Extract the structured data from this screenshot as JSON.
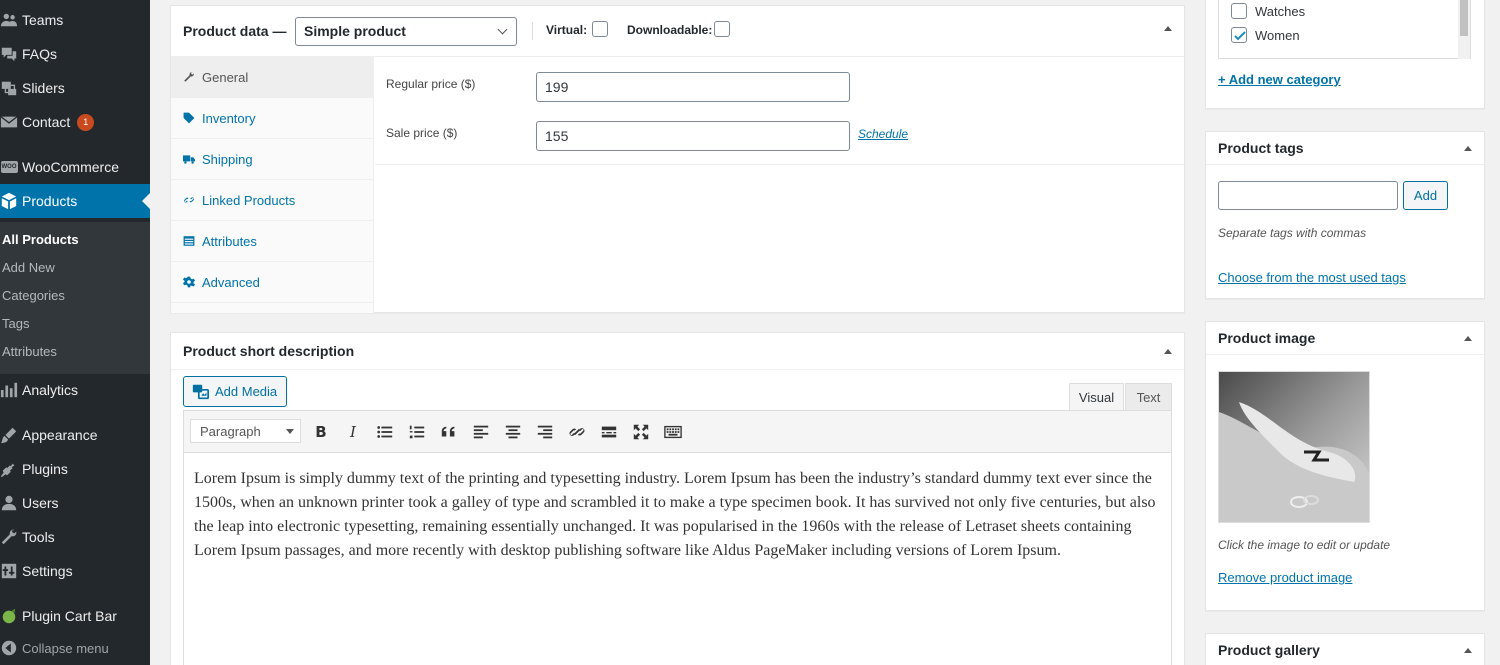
{
  "sidebar": {
    "items": [
      {
        "label": "Teams",
        "icon": "teams-icon"
      },
      {
        "label": "FAQs",
        "icon": "faqs-icon"
      },
      {
        "label": "Sliders",
        "icon": "sliders-icon"
      },
      {
        "label": "Contact",
        "icon": "contact-icon",
        "badge": "1"
      },
      {
        "label": "WooCommerce",
        "icon": "woocommerce-icon"
      },
      {
        "label": "Products",
        "icon": "products-icon"
      },
      {
        "label": "Analytics",
        "icon": "analytics-icon"
      },
      {
        "label": "Appearance",
        "icon": "appearance-icon"
      },
      {
        "label": "Plugins",
        "icon": "plugins-icon"
      },
      {
        "label": "Users",
        "icon": "users-icon"
      },
      {
        "label": "Tools",
        "icon": "tools-icon"
      },
      {
        "label": "Settings",
        "icon": "settings-icon"
      },
      {
        "label": "Plugin Cart Bar",
        "icon": "plugin-cart-bar-icon"
      },
      {
        "label": "Collapse menu",
        "icon": "collapse-icon"
      }
    ],
    "woo_logo_text": "WOO",
    "submenu": [
      "All Products",
      "Add New",
      "Categories",
      "Tags",
      "Attributes"
    ]
  },
  "product_data": {
    "title": "Product data —",
    "type_selected": "Simple product",
    "virtual_label": "Virtual:",
    "downloadable_label": "Downloadable:",
    "virtual_checked": false,
    "downloadable_checked": false,
    "tabs": [
      "General",
      "Inventory",
      "Shipping",
      "Linked Products",
      "Attributes",
      "Advanced"
    ],
    "regular_price_label": "Regular price ($)",
    "regular_price_value": "199",
    "sale_price_label": "Sale price ($)",
    "sale_price_value": "155",
    "schedule_link": "Schedule"
  },
  "short_description": {
    "title": "Product short description",
    "add_media": "Add Media",
    "tab_visual": "Visual",
    "tab_text": "Text",
    "format_selected": "Paragraph",
    "content": "Lorem Ipsum is simply dummy text of the printing and typesetting industry. Lorem Ipsum has been the industry’s standard dummy text ever since the 1500s, when an unknown printer took a galley of type and scrambled it to make a type specimen book. It has survived not only five centuries, but also the leap into electronic typesetting, remaining essentially unchanged. It was popularised in the 1960s with the release of Letraset sheets containing Lorem Ipsum passages, and more recently with desktop publishing software like Aldus PageMaker including versions of Lorem Ipsum."
  },
  "categories": {
    "items": [
      {
        "label": "Watches",
        "checked": false
      },
      {
        "label": "Women",
        "checked": true
      }
    ],
    "add_new": "+ Add new category"
  },
  "product_tags": {
    "title": "Product tags",
    "input_value": "",
    "add_button": "Add",
    "hint": "Separate tags with commas",
    "choose_link": "Choose from the most used tags"
  },
  "product_image": {
    "title": "Product image",
    "hint": "Click the image to edit or update",
    "remove_link": "Remove product image"
  },
  "product_gallery": {
    "title": "Product gallery"
  },
  "colors": {
    "admin_bar": "#23282d",
    "accent": "#0073aa",
    "badge": "#ca4a1f"
  }
}
